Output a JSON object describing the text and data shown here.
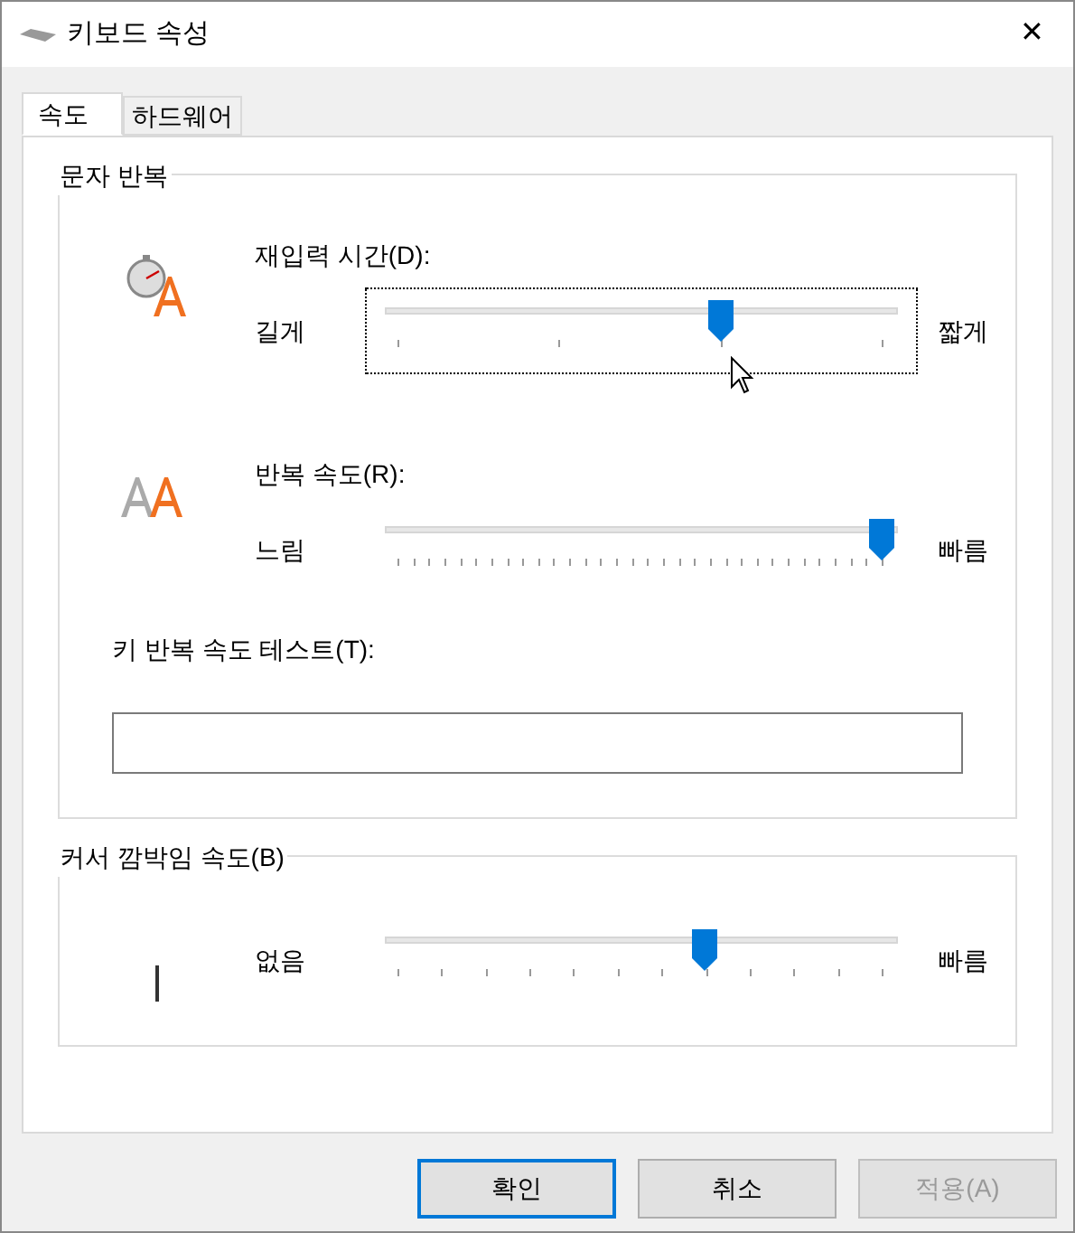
{
  "window": {
    "title": "키보드 속성",
    "close": "✕"
  },
  "tabs": [
    {
      "label": "속도",
      "selected": true
    },
    {
      "label": "하드웨어",
      "selected": false
    }
  ],
  "groups": [
    {
      "title": "문자 반복",
      "sliders": [
        {
          "kind": "delay",
          "label": "재입력 시간(D):",
          "min_label": "길게",
          "max_label": "짧게",
          "level": 0.667,
          "focused": true
        },
        {
          "kind": "rate",
          "label": "반복 속도(R):",
          "min_label": "느림",
          "max_label": "빠름",
          "level": 1,
          "focused": false
        }
      ],
      "test": {
        "label": "키 반복 속도 테스트(T):"
      }
    },
    {
      "title": "커서 깜박임 속도(B)",
      "sliders": [
        {
          "kind": "blink",
          "min_label": "없음",
          "max_label": "빠름",
          "level": 0.636,
          "focused": false
        }
      ]
    }
  ],
  "buttons": [
    {
      "label": "확인",
      "default": true,
      "disabled": false
    },
    {
      "label": "취소",
      "default": false,
      "disabled": false
    },
    {
      "label": "적용(A)",
      "default": false,
      "disabled": true
    }
  ]
}
